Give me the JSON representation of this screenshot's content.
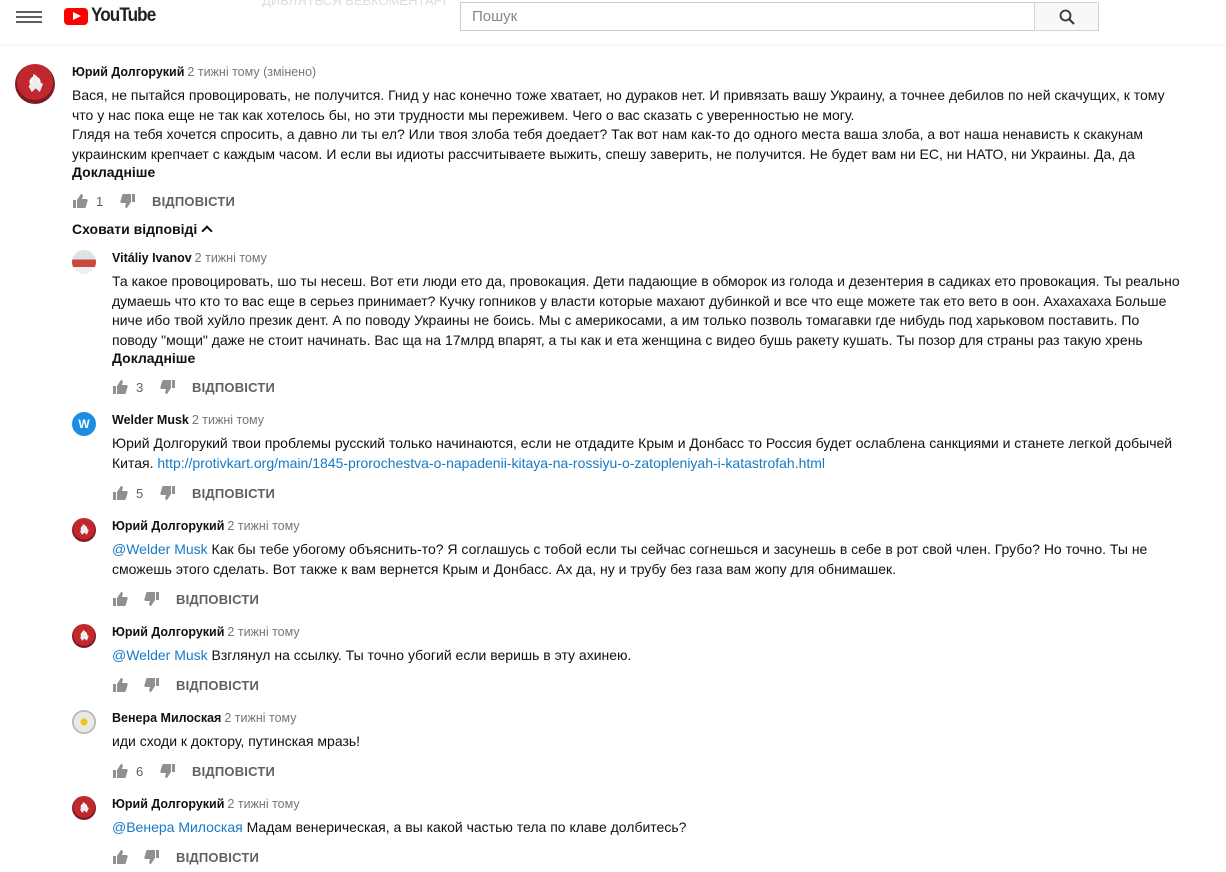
{
  "header": {
    "logo_text": "YouTube",
    "search_placeholder": "Пошук",
    "ghost_text": "ДИВЛЯТЬСЯ ВЕБКОМЕНТАРІ"
  },
  "labels": {
    "reply": "ВІДПОВІСТИ",
    "read_more": "Докладніше",
    "hide_replies": "Сховати відповіді"
  },
  "comments": [
    {
      "author": "Юрий Долгорукий",
      "time": "2 тижні тому (змінено)",
      "lines": [
        "Вася, не пытайся провоцировать, не получится. Гнид у нас конечно тоже хватает, но дураков нет. И привязать вашу Украину, а точнее дебилов по ней скачущих, к тому",
        "что у нас пока еще не так как хотелось бы, но эти трудности мы переживем. Чего о вас сказать с уверенностью не могу.",
        "Глядя на тебя хочется спросить, а давно ли  ты ел? Или твоя злоба тебя доедает? Так вот нам как-то до одного места ваша злоба, а вот наша ненависть к скакунам",
        "украинским крепчает с каждым часом. И если вы идиоты рассчитываете выжить, спешу заверить, не получится. Не будет вам ни ЕС, ни НАТО, ни Украины. Да, да"
      ],
      "likes": "1"
    },
    {
      "author": "Vitáliy Ivanov",
      "time": "2 тижні тому",
      "lines": [
        "Та какое провоцировать, шо ты несеш. Вот ети люди ето да, провокация. Дети падающие в обморок из голода и дезентерия в садиках ето провокация. Ты реально",
        "думаешь что кто то вас еще в серьез принимает? Кучку гопников у власти которые махают дубинкой и все что еще можете так ето вето в оон. Ахахахаха Больше",
        "ниче ибо твой хуйло презик дент. А по поводу Украины не боись. Мы с америкосами, а им только позволь томагавки где нибудь под харьковом поставить. По",
        "поводу \"мощи\" даже не стоит начинать. Вас ща на 17млрд впарят, а ты как и ета женщина с видео бушь ракету кушать. Ты позор для страны раз  такую хрень"
      ],
      "likes": "3"
    },
    {
      "author": "Welder Musk",
      "time": "2 тижні тому",
      "line1": "Юрий Долгорукий  твои проблемы русский только начинаются,  если не отдадите Крым и Донбасс то Россия будет ослаблена санкциями и станете легкой добычей",
      "line2_prefix": "Китая. ",
      "link": "http://protivkart.org/main/1845-prorochestva-o-napadenii-kitaya-na-rossiyu-o-zatopleniyah-i-katastrofah.html",
      "likes": "5"
    },
    {
      "author": "Юрий Долгорукий",
      "time": "2 тижні тому",
      "mention": "@Welder Musk",
      "line1": " Как бы тебе убогому объяснить-то? Я соглашусь с тобой если ты сейчас согнешься и засунешь в себе в рот свой член. Грубо? Но точно. Ты не",
      "line2": "сможешь этого сделать. Вот также к вам вернется Крым и Донбасс. Ах да, ну и трубу без газа вам жопу для обнимашек."
    },
    {
      "author": "Юрий Долгорукий",
      "time": "2 тижні тому",
      "mention": "@Welder Musk",
      "line1": " Взглянул на ссылку. Ты точно убогий если веришь в эту ахинею."
    },
    {
      "author": "Венера Милоская",
      "time": "2 тижні тому",
      "line1": "иди сходи к доктору, путинская мразь!",
      "likes": "6"
    },
    {
      "author": "Юрий Долгорукий",
      "time": "2 тижні тому",
      "mention": "@Венера Милоская",
      "line1": " Мадам венерическая, а вы какой частью тела по клаве долбитесь?"
    }
  ]
}
